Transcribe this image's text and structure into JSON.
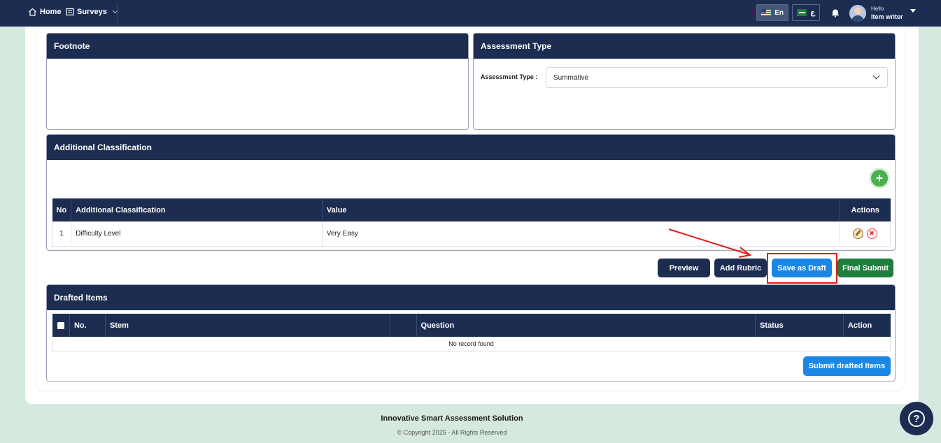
{
  "topbar": {
    "home_label": "Home",
    "surveys_label": "Surveys",
    "lang_en": "En",
    "lang_ar": "ع",
    "user_greeting": "Hello",
    "user_name": "Item writer"
  },
  "footnote_panel": {
    "title": "Footnote"
  },
  "assessment_panel": {
    "title": "Assessment Type",
    "field_label": "Assessment Type :",
    "selected_value": "Summative"
  },
  "classification_panel": {
    "title": "Additional Classification",
    "columns": [
      "No",
      "Additional Classification",
      "Value",
      "Actions"
    ],
    "rows": [
      {
        "no": "1",
        "classification": "Difficulty Level",
        "value": "Very Easy"
      }
    ]
  },
  "actions": {
    "preview": "Preview",
    "add_rubric": "Add Rubric",
    "save_draft": "Save as Draft",
    "final_submit": "Final Submit"
  },
  "drafted_panel": {
    "title": "Drafted Items",
    "columns": [
      "No.",
      "Stem",
      "",
      "Question",
      "Status",
      "Action"
    ],
    "empty_message": "No record found",
    "submit_button": "Submit drafted Items"
  },
  "footer": {
    "title": "Innovative Smart Assessment Solution",
    "copyright": "© Copyright 2025 - All Rights Reserved"
  },
  "colors": {
    "navy": "#1d2d52",
    "accent_blue": "#1a87e6",
    "green": "#1e7e3e",
    "highlight_red": "#e21b1b",
    "background_mint": "#d5e9df"
  }
}
